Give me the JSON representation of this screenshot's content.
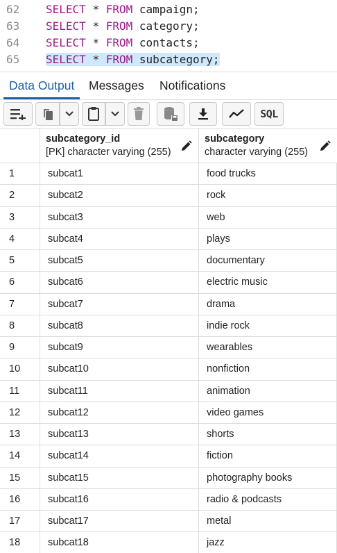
{
  "editor": {
    "lines": [
      {
        "number": "62",
        "keyword1": "SELECT",
        "star": "*",
        "keyword2": "FROM",
        "table": "campaign",
        "end": ";"
      },
      {
        "number": "63",
        "keyword1": "SELECT",
        "star": "*",
        "keyword2": "FROM",
        "table": "category",
        "end": ";"
      },
      {
        "number": "64",
        "keyword1": "SELECT",
        "star": "*",
        "keyword2": "FROM",
        "table": "contacts",
        "end": ";"
      },
      {
        "number": "65",
        "keyword1": "SELECT",
        "star": "*",
        "keyword2": "FROM",
        "table": "subcategory",
        "end": ";"
      }
    ]
  },
  "tabs": [
    {
      "label": "Data Output",
      "active": true
    },
    {
      "label": "Messages",
      "active": false
    },
    {
      "label": "Notifications",
      "active": false
    }
  ],
  "toolbar": {
    "sql_label": "SQL"
  },
  "grid": {
    "columns": [
      {
        "name": "subcategory_id",
        "type": "[PK] character varying (255)"
      },
      {
        "name": "subcategory",
        "type": "character varying (255)"
      }
    ],
    "rows": [
      {
        "num": "1",
        "id": "subcat1",
        "name": "food trucks"
      },
      {
        "num": "2",
        "id": "subcat2",
        "name": "rock"
      },
      {
        "num": "3",
        "id": "subcat3",
        "name": "web"
      },
      {
        "num": "4",
        "id": "subcat4",
        "name": "plays"
      },
      {
        "num": "5",
        "id": "subcat5",
        "name": "documentary"
      },
      {
        "num": "6",
        "id": "subcat6",
        "name": "electric music"
      },
      {
        "num": "7",
        "id": "subcat7",
        "name": "drama"
      },
      {
        "num": "8",
        "id": "subcat8",
        "name": "indie rock"
      },
      {
        "num": "9",
        "id": "subcat9",
        "name": "wearables"
      },
      {
        "num": "10",
        "id": "subcat10",
        "name": "nonfiction"
      },
      {
        "num": "11",
        "id": "subcat11",
        "name": "animation"
      },
      {
        "num": "12",
        "id": "subcat12",
        "name": "video games"
      },
      {
        "num": "13",
        "id": "subcat13",
        "name": "shorts"
      },
      {
        "num": "14",
        "id": "subcat14",
        "name": "fiction"
      },
      {
        "num": "15",
        "id": "subcat15",
        "name": "photography books"
      },
      {
        "num": "16",
        "id": "subcat16",
        "name": "radio & podcasts"
      },
      {
        "num": "17",
        "id": "subcat17",
        "name": "metal"
      },
      {
        "num": "18",
        "id": "subcat18",
        "name": "jazz"
      }
    ]
  },
  "colors": {
    "keyword": "#9a1b8a",
    "accent": "#1f5fa6",
    "selection": "#cfe8fc"
  }
}
